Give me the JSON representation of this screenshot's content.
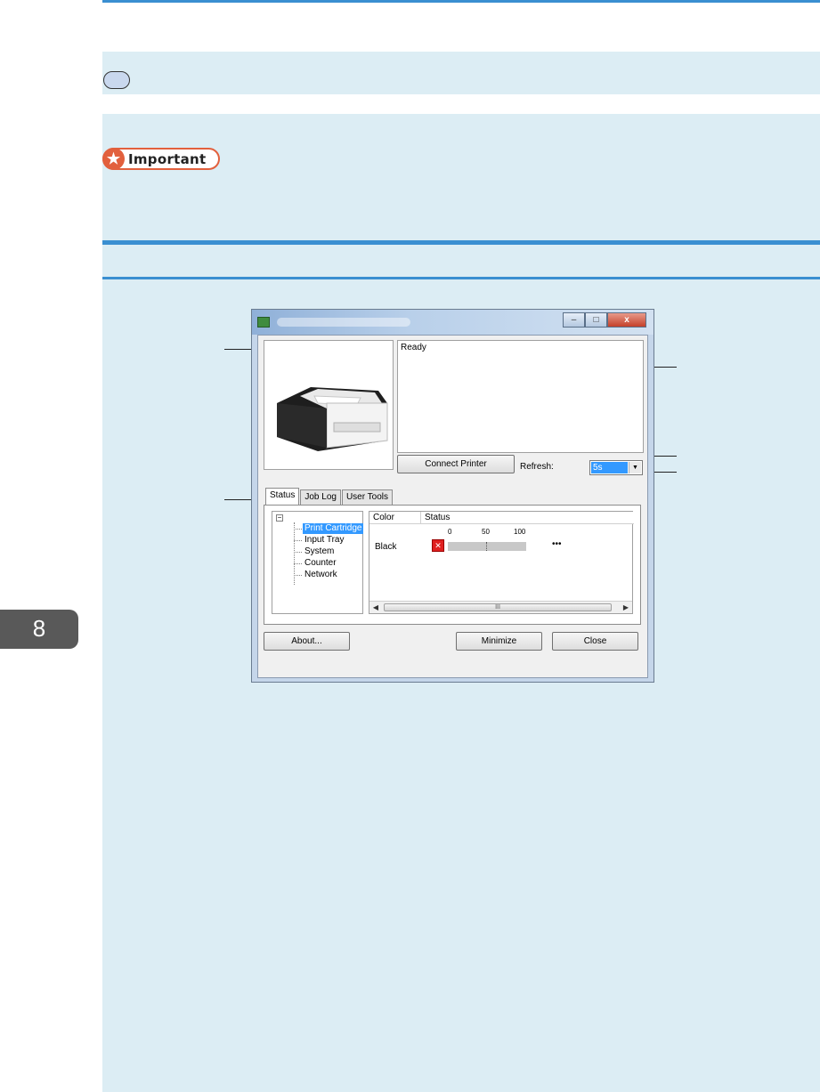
{
  "page": {
    "important_label": "Important",
    "chapter_number": "8"
  },
  "window": {
    "status_text": "Ready",
    "connect_button": "Connect Printer",
    "refresh_label": "Refresh:",
    "refresh_value": "5s",
    "tabs": [
      "Status",
      "Job Log",
      "User Tools"
    ],
    "tree": {
      "root_symbol": "−",
      "items": [
        "Print Cartridge",
        "Input Tray",
        "System",
        "Counter",
        "Network"
      ],
      "selected_index": 0
    },
    "list": {
      "columns": [
        "Color",
        "Status"
      ],
      "scale": [
        "0",
        "50",
        "100"
      ],
      "rows": [
        {
          "color": "Black",
          "level_percent": 0,
          "remaining": "•••"
        }
      ],
      "scroll_thumb_glyph": "III"
    },
    "buttons": {
      "about": "About...",
      "minimize": "Minimize",
      "close": "Close"
    },
    "titlebar_buttons": [
      "–",
      "□",
      "x"
    ]
  },
  "icons": {
    "app_icon": "printer-app-icon",
    "warning_icon": "cartridge-warning-icon",
    "important_icon": "star-icon"
  },
  "colors": {
    "accent_rule": "#3a8fd1",
    "band": "#dcedf4",
    "important_border": "#e2603d",
    "selection": "#3399ff"
  }
}
